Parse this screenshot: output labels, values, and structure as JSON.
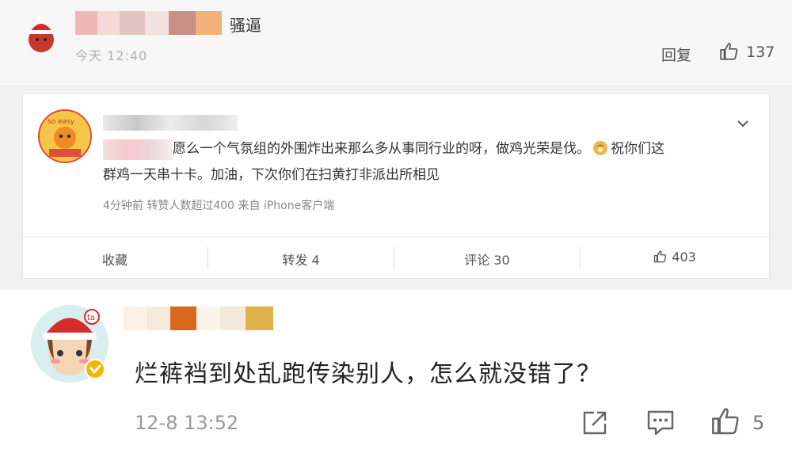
{
  "top_comment": {
    "username": "骚逼",
    "time": "今天 12:40",
    "reply_label": "回复",
    "like_count": "137"
  },
  "quoted_post": {
    "text_line1": "愿么一个气氛组的外围炸出来那么多从事同行业的呀，做鸡光荣是伐。",
    "text_line1_tail": "祝你们这",
    "text_line2": "群鸡一天串十卡。加油，下次你们在扫黄打非派出所相见",
    "meta": "4分钟前  转赞人数超过400  来自 iPhone客户端",
    "actions": {
      "collect": "收藏",
      "repost": "转发 4",
      "comment": "评论 30",
      "like": "403"
    }
  },
  "bottom_comment": {
    "text": "烂裤裆到处乱跑传染别人，怎么就没错了？",
    "time": "12-8 13:52",
    "like_count": "5"
  },
  "colors": {
    "top_bg": "#f7f7f7",
    "card_bg": "#f1f1f1",
    "muted_text": "#999999",
    "verified_badge": "#f5b400"
  }
}
